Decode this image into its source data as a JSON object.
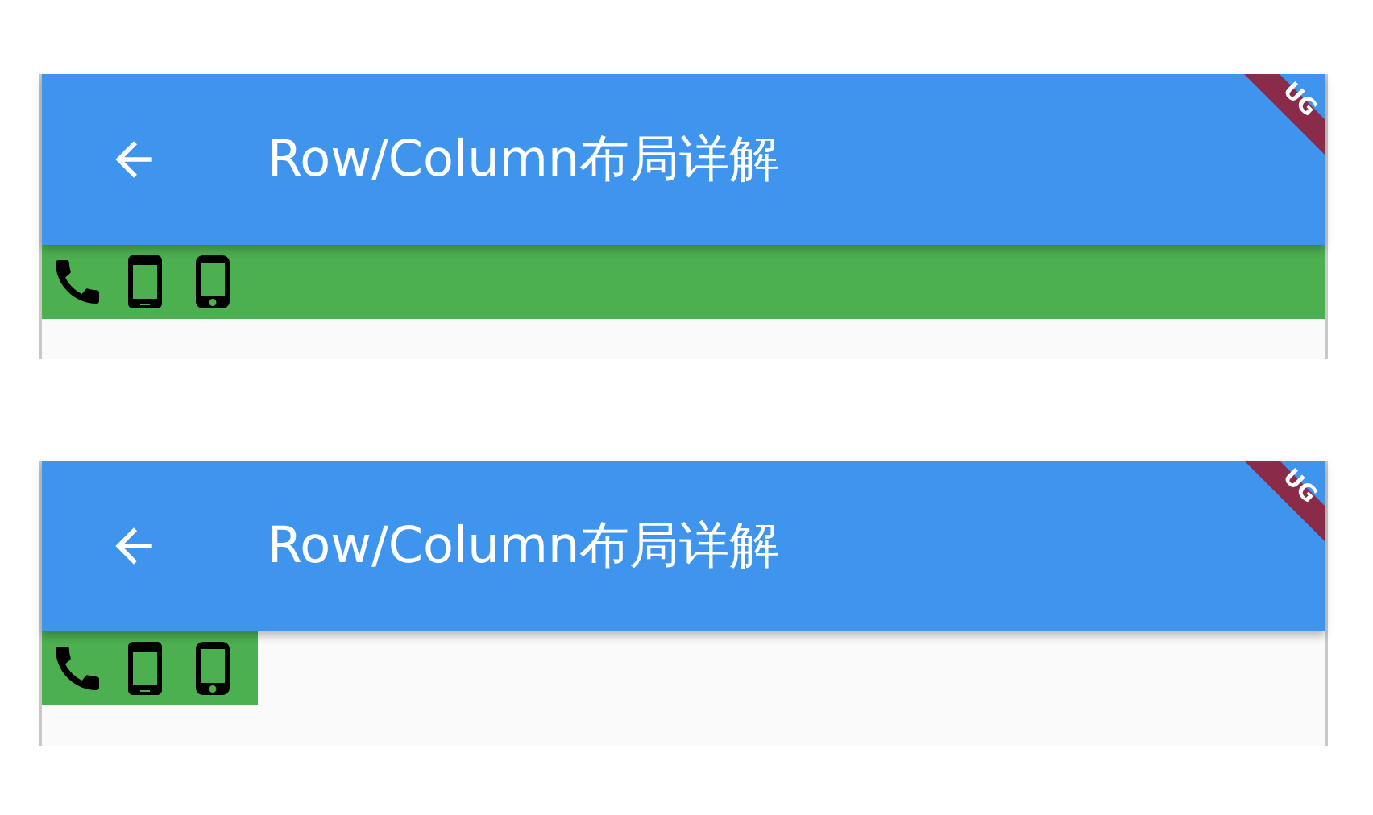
{
  "screens": [
    {
      "app_bar": {
        "title": "Row/Column布局详解",
        "banner": "UG"
      },
      "row": {
        "full_width": true
      }
    },
    {
      "app_bar": {
        "title": "Row/Column布局详解",
        "banner": "UG"
      },
      "row": {
        "full_width": false
      }
    }
  ]
}
